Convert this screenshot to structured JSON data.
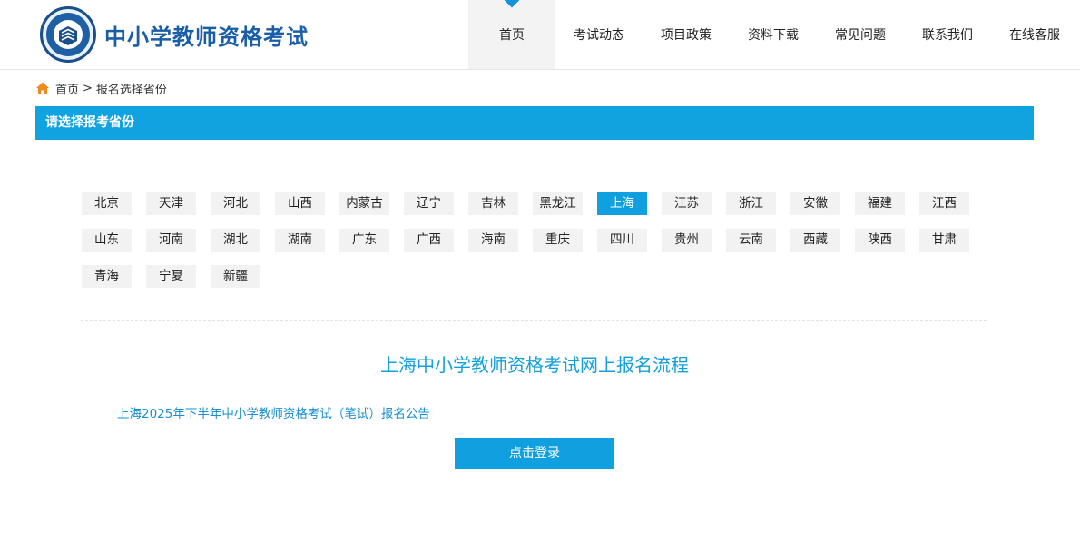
{
  "header": {
    "site_title": "中小学教师资格考试",
    "logo_icon": "book-shield-emblem-icon",
    "nav": [
      {
        "label": "首页",
        "active": true
      },
      {
        "label": "考试动态"
      },
      {
        "label": "项目政策"
      },
      {
        "label": "资料下载"
      },
      {
        "label": "常见问题"
      },
      {
        "label": "联系我们"
      },
      {
        "label": "在线客服"
      }
    ]
  },
  "breadcrumb": {
    "icon": "home-icon",
    "home": "首页",
    "separator": ">",
    "current": "报名选择省份"
  },
  "section_bar": {
    "title": "请选择报考省份"
  },
  "provinces": {
    "selected": "上海",
    "items": [
      "北京",
      "天津",
      "河北",
      "山西",
      "内蒙古",
      "辽宁",
      "吉林",
      "黑龙江",
      "上海",
      "江苏",
      "浙江",
      "安徽",
      "福建",
      "江西",
      "山东",
      "河南",
      "湖北",
      "湖南",
      "广东",
      "广西",
      "海南",
      "重庆",
      "四川",
      "贵州",
      "云南",
      "西藏",
      "陕西",
      "甘肃",
      "青海",
      "宁夏",
      "新疆"
    ]
  },
  "flow": {
    "title": "上海中小学教师资格考试网上报名流程",
    "notice_link": "上海2025年下半年中小学教师资格考试（笔试）报名公告",
    "login_button": "点击登录"
  },
  "colors": {
    "accent": "#10a0df",
    "brand": "#1a5ea8",
    "home_icon": "#f08a1c"
  }
}
